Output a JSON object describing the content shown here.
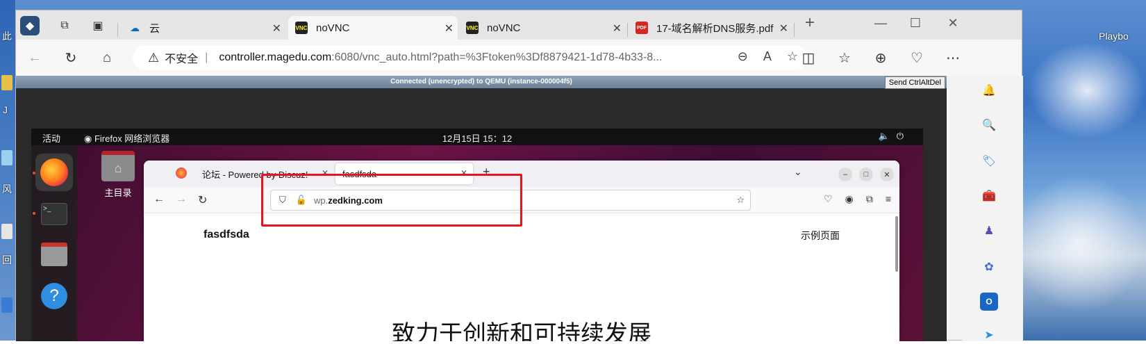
{
  "desktop": {
    "labels": [
      "此",
      "Playbo",
      "J",
      "回",
      "风"
    ]
  },
  "browser": {
    "tabs": [
      {
        "label": "云",
        "favicon": "cloud-icon",
        "active": false
      },
      {
        "label": "noVNC",
        "favicon": "vnc-icon",
        "active": true
      },
      {
        "label": "noVNC",
        "favicon": "vnc-icon",
        "active": false
      },
      {
        "label": "17-域名解析DNS服务.pdf",
        "favicon": "pdf-icon",
        "active": false
      }
    ],
    "address": {
      "insecure_label": "不安全",
      "host": "controller.magedu.com",
      "path": ":6080/vnc_auto.html?path=%3Ftoken%3Df8879421-1d78-4b33-8..."
    }
  },
  "vnc": {
    "status": "Connected (unencrypted) to QEMU (instance-000004f5)",
    "send_button": "Send CtrlAltDel"
  },
  "ubuntu": {
    "activities": "活动",
    "app_name": "Firefox 网络浏览器",
    "clock": "12月15日  15：12",
    "home_folder": "主目录"
  },
  "firefox": {
    "tabs": [
      {
        "label": "论坛 - Powered by Discuz!",
        "active": false
      },
      {
        "label": "fasdfsda",
        "active": true
      }
    ],
    "url_sub": "wp.",
    "url_domain": "zedking.com",
    "site_title": "fasdfsda",
    "site_menu": "示例页面",
    "headline": "致力于创新和可持续发展"
  },
  "colors": {
    "highlight_box": "#e5151b",
    "ubuntu_orange": "#e95420"
  }
}
